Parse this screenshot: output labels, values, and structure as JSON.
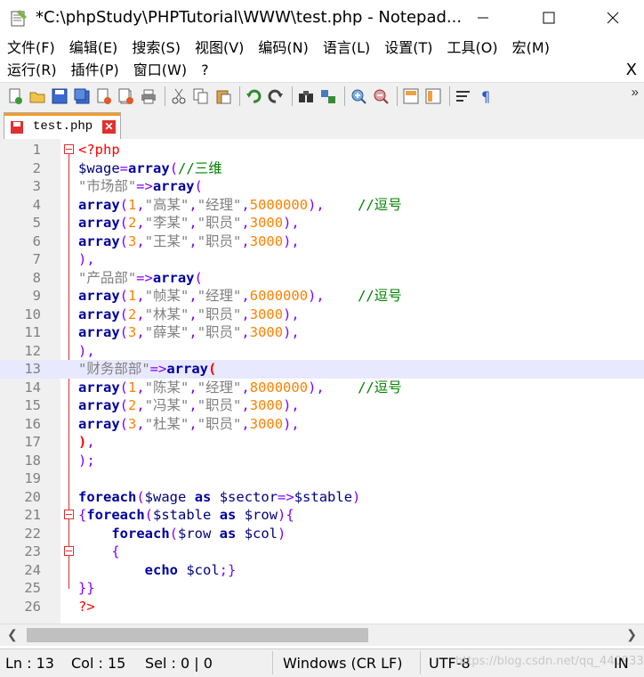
{
  "window": {
    "title": "*C:\\phpStudy\\PHPTutorial\\WWW\\test.php - Notepad..."
  },
  "menu": {
    "row1": [
      "文件(F)",
      "编辑(E)",
      "搜索(S)",
      "视图(V)",
      "编码(N)",
      "语言(L)",
      "设置(T)",
      "工具(O)",
      "宏(M)"
    ],
    "row2": [
      "运行(R)",
      "插件(P)",
      "窗口(W)",
      "?"
    ],
    "close_label": "X"
  },
  "toolbar": {
    "icons": [
      "new-file-icon",
      "open-file-icon",
      "save-icon",
      "save-all-icon",
      "close-icon",
      "close-all-icon",
      "print-icon",
      "cut-icon",
      "copy-icon",
      "paste-icon",
      "undo-icon",
      "redo-icon",
      "find-icon",
      "replace-icon",
      "zoom-in-icon",
      "zoom-out-icon",
      "sync-v-icon",
      "sync-h-icon",
      "word-wrap-icon",
      "show-all-chars-icon"
    ],
    "more": "»"
  },
  "tab": {
    "label": "test.php",
    "close": "✕"
  },
  "editor": {
    "current_line": 13,
    "lines": [
      "1",
      "2",
      "3",
      "4",
      "5",
      "6",
      "7",
      "8",
      "9",
      "10",
      "11",
      "12",
      "13",
      "14",
      "15",
      "16",
      "17",
      "18",
      "19",
      "20",
      "21",
      "22",
      "23",
      "24",
      "25",
      "26"
    ]
  },
  "status": {
    "ln": "Ln : 13",
    "col": "Col : 15",
    "sel": "Sel : 0 | 0",
    "eol": "Windows (CR LF)",
    "encoding": "UTF-8",
    "mode": "IN",
    "watermark": "https://blog.csdn.net/qq_44093397"
  },
  "colors": {
    "keyword": "#0000ff",
    "string": "#808080",
    "number": "#ff8000",
    "comment": "#008000",
    "php_tag": "#ff0000",
    "operator": "#8000ff",
    "current_line": "#e8e8ff",
    "tab_accent": "#f79a21"
  }
}
